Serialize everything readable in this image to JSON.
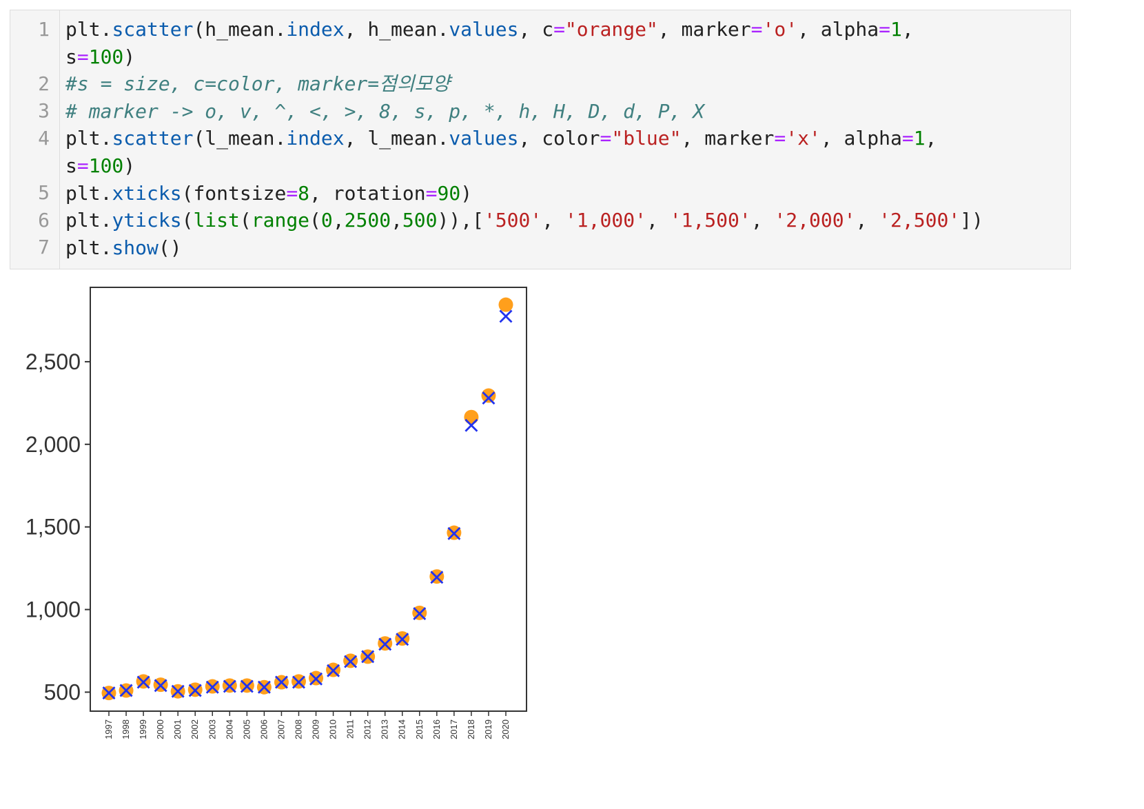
{
  "code_cell": {
    "line_numbers": [
      "1",
      "2",
      "3",
      "4",
      "5",
      "6",
      "7"
    ],
    "lines": [
      [
        [
          "plt.",
          ""
        ],
        [
          "scatter",
          "kw-fn"
        ],
        [
          "(h_mean.",
          ""
        ],
        [
          "index",
          "kw-fn"
        ],
        [
          ", h_mean.",
          ""
        ],
        [
          "values",
          "kw-fn"
        ],
        [
          ", c",
          ""
        ],
        [
          "=",
          "op"
        ],
        [
          "\"orange\"",
          "str"
        ],
        [
          ", marker",
          ""
        ],
        [
          "=",
          "op"
        ],
        [
          "'o'",
          "str"
        ],
        [
          ", alpha",
          ""
        ],
        [
          "=",
          "op"
        ],
        [
          "1",
          "num"
        ],
        [
          ",",
          ""
        ]
      ],
      [
        [
          "s",
          ""
        ],
        [
          "=",
          "op"
        ],
        [
          "100",
          "num"
        ],
        [
          ")",
          ""
        ]
      ],
      [
        [
          "#s = size, c=color, marker=점의모양",
          "cm"
        ]
      ],
      [
        [
          "# marker -> o, v, ^, <, >, 8, s, p, *, h, H, D, d, P, X",
          "cm"
        ]
      ],
      [
        [
          "plt.",
          ""
        ],
        [
          "scatter",
          "kw-fn"
        ],
        [
          "(l_mean.",
          ""
        ],
        [
          "index",
          "kw-fn"
        ],
        [
          ", l_mean.",
          ""
        ],
        [
          "values",
          "kw-fn"
        ],
        [
          ", color",
          ""
        ],
        [
          "=",
          "op"
        ],
        [
          "\"blue\"",
          "str"
        ],
        [
          ", marker",
          ""
        ],
        [
          "=",
          "op"
        ],
        [
          "'x'",
          "str"
        ],
        [
          ", alpha",
          ""
        ],
        [
          "=",
          "op"
        ],
        [
          "1",
          "num"
        ],
        [
          ",",
          ""
        ]
      ],
      [
        [
          "s",
          ""
        ],
        [
          "=",
          "op"
        ],
        [
          "100",
          "num"
        ],
        [
          ")",
          ""
        ]
      ],
      [
        [
          "plt.",
          ""
        ],
        [
          "xticks",
          "kw-fn"
        ],
        [
          "(fontsize",
          ""
        ],
        [
          "=",
          "op"
        ],
        [
          "8",
          "num"
        ],
        [
          ", rotation",
          ""
        ],
        [
          "=",
          "op"
        ],
        [
          "90",
          "num"
        ],
        [
          ")",
          ""
        ]
      ],
      [
        [
          "plt.",
          ""
        ],
        [
          "yticks",
          "kw-fn"
        ],
        [
          "(",
          ""
        ],
        [
          "list",
          "num"
        ],
        [
          "(",
          ""
        ],
        [
          "range",
          "num"
        ],
        [
          "(",
          ""
        ],
        [
          "0",
          "num"
        ],
        [
          ",",
          ""
        ],
        [
          "2500",
          "num"
        ],
        [
          ",",
          ""
        ],
        [
          "500",
          "num"
        ],
        [
          ")),[",
          ""
        ],
        [
          "'500'",
          "str"
        ],
        [
          ", ",
          ""
        ],
        [
          "'1,000'",
          "str"
        ],
        [
          ", ",
          ""
        ],
        [
          "'1,500'",
          "str"
        ],
        [
          ", ",
          ""
        ],
        [
          "'2,000'",
          "str"
        ],
        [
          ", ",
          ""
        ],
        [
          "'2,500'",
          "str"
        ],
        [
          "])",
          ""
        ]
      ],
      [
        [
          "plt.",
          ""
        ],
        [
          "show",
          "kw-fn"
        ],
        [
          "()",
          ""
        ]
      ]
    ]
  },
  "chart_data": {
    "type": "scatter",
    "x": [
      "1997",
      "1998",
      "1999",
      "2000",
      "2001",
      "2002",
      "2003",
      "2004",
      "2005",
      "2006",
      "2007",
      "2008",
      "2009",
      "2010",
      "2011",
      "2012",
      "2013",
      "2014",
      "2015",
      "2016",
      "2017",
      "2018",
      "2019",
      "2020"
    ],
    "series": [
      {
        "color": "#ff9f1c",
        "marker": "o",
        "values": [
          495,
          510,
          565,
          545,
          505,
          515,
          535,
          540,
          540,
          530,
          560,
          565,
          585,
          635,
          690,
          715,
          795,
          825,
          980,
          1200,
          1465,
          2165,
          2295,
          2845
        ]
      },
      {
        "color": "#2233ee",
        "marker": "x",
        "values": [
          495,
          510,
          560,
          540,
          505,
          510,
          530,
          535,
          535,
          530,
          560,
          560,
          580,
          630,
          685,
          715,
          790,
          820,
          975,
          1195,
          1460,
          2115,
          2280,
          2775
        ]
      }
    ],
    "yticks": [
      500,
      1000,
      1500,
      2000,
      2500
    ],
    "yticklabels": [
      "500",
      "1,000",
      "1,500",
      "2,000",
      "2,500"
    ],
    "ylim": [
      385,
      2950
    ],
    "title": "",
    "xlabel": "",
    "ylabel": ""
  }
}
